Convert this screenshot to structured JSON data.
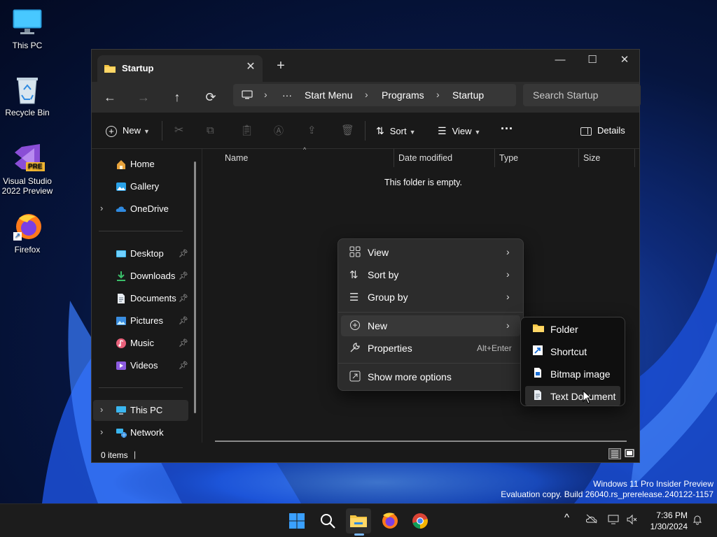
{
  "desktop": {
    "icons": [
      {
        "label": "This PC",
        "icon": "monitor-icon"
      },
      {
        "label": "Recycle Bin",
        "icon": "recycle-bin-icon"
      },
      {
        "label": "Visual Studio 2022 Preview",
        "icon": "visual-studio-icon",
        "badge": "PRE"
      },
      {
        "label": "Firefox",
        "icon": "firefox-icon"
      }
    ]
  },
  "explorer": {
    "tab_title": "Startup",
    "tab_close": "✕",
    "new_tab": "+",
    "window_controls": {
      "minimize": "—",
      "maximize": "☐",
      "close": "✕"
    },
    "nav": {
      "back": "←",
      "forward": "→",
      "up": "↑",
      "refresh": "⟳"
    },
    "breadcrumb": {
      "more": "···",
      "items": [
        "Start Menu",
        "Programs",
        "Startup"
      ],
      "separator": "›"
    },
    "search_placeholder": "Search Startup",
    "commands": {
      "new": "New",
      "sort": "Sort",
      "view": "View",
      "more": "···",
      "details": "Details"
    },
    "sidebar": {
      "items": [
        {
          "label": "Home",
          "icon": "home-icon"
        },
        {
          "label": "Gallery",
          "icon": "gallery-icon"
        },
        {
          "label": "OneDrive",
          "icon": "onedrive-icon"
        },
        {
          "label": "Desktop",
          "icon": "desktop-folder-icon"
        },
        {
          "label": "Downloads",
          "icon": "downloads-icon"
        },
        {
          "label": "Documents",
          "icon": "documents-icon"
        },
        {
          "label": "Pictures",
          "icon": "pictures-icon"
        },
        {
          "label": "Music",
          "icon": "music-icon"
        },
        {
          "label": "Videos",
          "icon": "videos-icon"
        },
        {
          "label": "This PC",
          "icon": "this-pc-icon"
        },
        {
          "label": "Network",
          "icon": "network-icon"
        }
      ]
    },
    "columns": [
      "Name",
      "Date modified",
      "Type",
      "Size"
    ],
    "empty_message": "This folder is empty.",
    "status": {
      "item_count": "0 items",
      "cursor": "|"
    }
  },
  "context_menu": {
    "items": [
      {
        "label": "View",
        "icon": "view-grid-icon"
      },
      {
        "label": "Sort by",
        "icon": "sort-icon"
      },
      {
        "label": "Group by",
        "icon": "group-icon"
      },
      {
        "label": "New",
        "icon": "new-plus-icon"
      },
      {
        "label": "Properties",
        "icon": "properties-wrench-icon",
        "accelerator": "Alt+Enter"
      },
      {
        "label": "Show more options",
        "icon": "show-more-icon"
      }
    ],
    "submenu": [
      {
        "label": "Folder",
        "icon": "folder-icon"
      },
      {
        "label": "Shortcut",
        "icon": "shortcut-icon"
      },
      {
        "label": "Bitmap image",
        "icon": "bitmap-icon"
      },
      {
        "label": "Text Document",
        "icon": "text-document-icon"
      }
    ]
  },
  "watermark": {
    "line1": "Windows 11 Pro Insider Preview",
    "line2": "Evaluation copy. Build 26040.rs_prerelease.240122-1157"
  },
  "taskbar": {
    "apps": [
      "start-icon",
      "search-icon",
      "file-explorer-icon",
      "firefox-icon",
      "chrome-icon"
    ],
    "tray": {
      "chevron": "^"
    },
    "time": "7:36 PM",
    "date": "1/30/2024"
  },
  "colors": {
    "accent": "#4cc2ff",
    "folder": "#f4c542",
    "selection": "#2d2d2d"
  }
}
